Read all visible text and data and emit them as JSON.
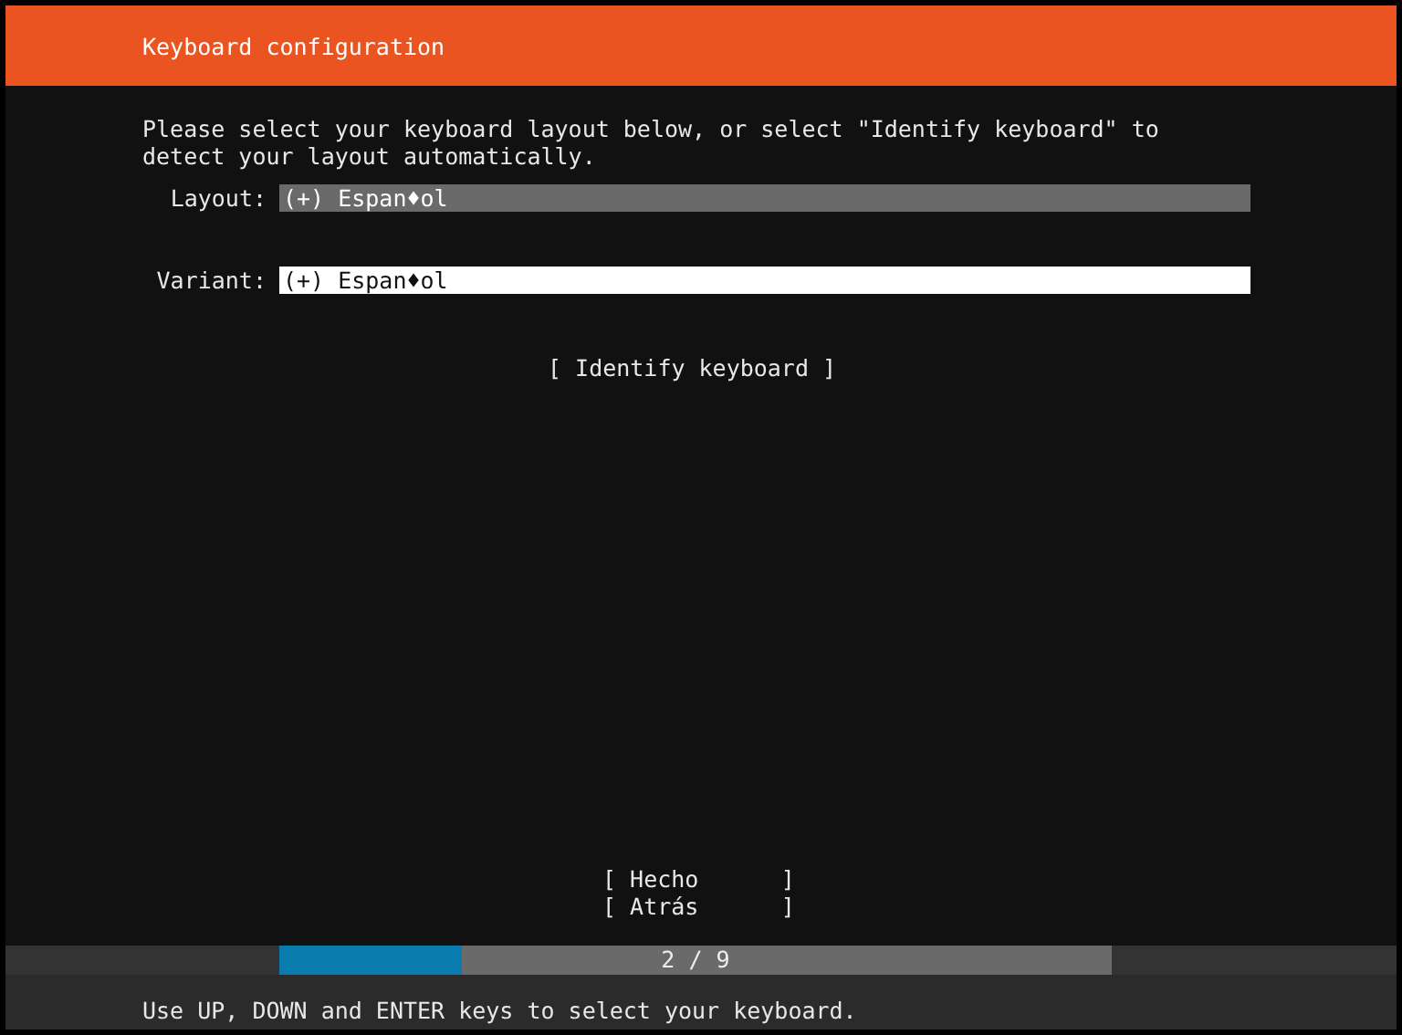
{
  "header": {
    "title": "Keyboard configuration"
  },
  "instructions": "Please select your keyboard layout below, or select \"Identify keyboard\" to detect your layout automatically.",
  "fields": [
    {
      "label": "Layout:",
      "value": "(+) Espan♦ol",
      "highlighted": true
    },
    {
      "label": "Variant:",
      "value": "(+) Espan♦ol",
      "highlighted": false
    }
  ],
  "identify_button": "[ Identify keyboard ]",
  "buttons": [
    "[ Hecho      ]",
    "[ Atrás      ]"
  ],
  "progress": {
    "level": 0.22,
    "label": "2 / 9"
  },
  "status_bar": "Use UP, DOWN and ENTER keys to select your keyboard."
}
